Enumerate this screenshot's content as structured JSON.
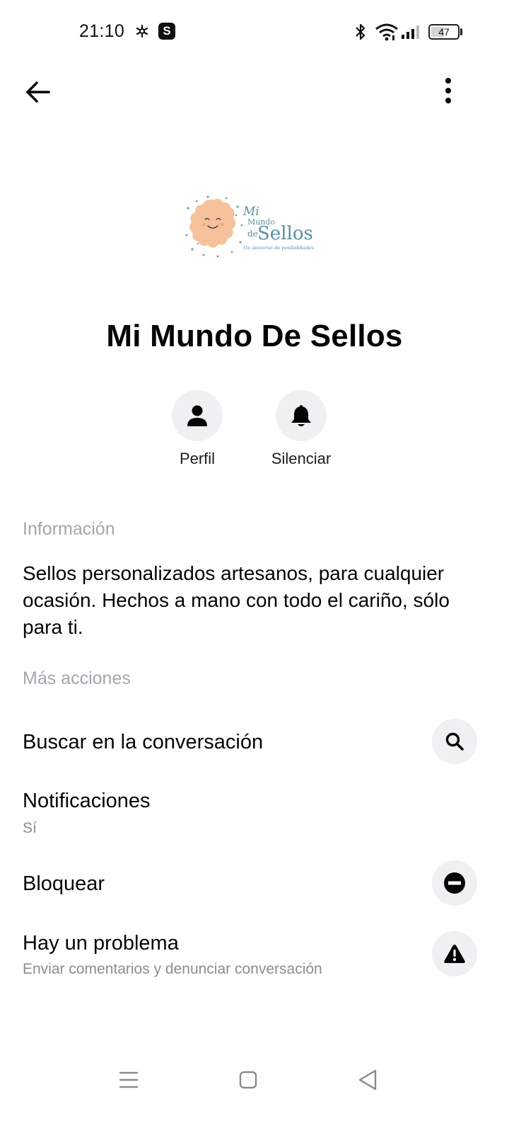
{
  "status_bar": {
    "time": "21:10",
    "app_badge": "S",
    "battery": "47"
  },
  "header": {
    "back_icon": "arrow-left-icon",
    "more_icon": "more-vertical-icon"
  },
  "logo": {
    "line1": "Mi",
    "line2": "Mundo",
    "line3_small": "de",
    "line3": "Sellos",
    "tagline": "Un universo de posibilidades",
    "colors": {
      "sun": "#f6c29c",
      "text": "#5b8fa0",
      "dots": "#6b9eae"
    }
  },
  "page_name": "Mi Mundo De Sellos",
  "actions": [
    {
      "label": "Perfil",
      "icon": "person-icon"
    },
    {
      "label": "Silenciar",
      "icon": "bell-icon"
    }
  ],
  "info": {
    "header": "Información",
    "text": "Sellos personalizados artesanos, para cualquier ocasión. Hechos a mano con todo el cariño, sólo para ti."
  },
  "more_actions": {
    "header": "Más acciones",
    "items": [
      {
        "title": "Buscar en la conversación",
        "subtitle": "",
        "icon": "search-icon"
      },
      {
        "title": "Notificaciones",
        "subtitle": "Sí",
        "icon": ""
      },
      {
        "title": "Bloquear",
        "subtitle": "",
        "icon": "block-icon"
      },
      {
        "title": "Hay un problema",
        "subtitle": "Enviar comentarios y denunciar conversación",
        "icon": "warning-icon"
      }
    ]
  },
  "nav_bar": {
    "menu_icon": "menu-icon",
    "home_icon": "home-square-icon",
    "back_icon": "back-triangle-icon"
  }
}
